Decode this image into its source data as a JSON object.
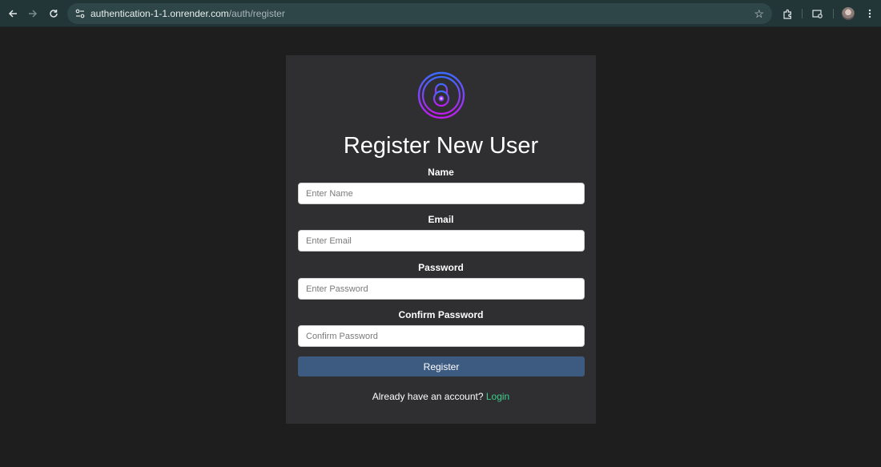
{
  "browser": {
    "url_host": "authentication-1-1.onrender.com",
    "url_path": "/auth/register",
    "icons": [
      "back-icon",
      "forward-icon",
      "reload-icon",
      "site-info-icon",
      "bookmark-star-icon",
      "extensions-icon",
      "media-controls-icon",
      "profile-avatar",
      "menu-icon"
    ]
  },
  "form": {
    "title": "Register New User",
    "fields": [
      {
        "label": "Name",
        "placeholder": "Enter Name",
        "value": ""
      },
      {
        "label": "Email",
        "placeholder": "Enter Email",
        "value": ""
      },
      {
        "label": "Password",
        "placeholder": "Enter Password",
        "value": ""
      },
      {
        "label": "Confirm Password",
        "placeholder": "Confirm Password",
        "value": ""
      }
    ],
    "submit_label": "Register",
    "footer_text": "Already have an account?",
    "login_link": "Login"
  },
  "colors": {
    "page_bg": "#1e1e1f",
    "card_bg": "#2f2e31",
    "button_bg": "#3d5a80",
    "link": "#3ecf8e",
    "logo_gradient_start": "#3b6bff",
    "logo_gradient_end": "#c21cf0"
  }
}
